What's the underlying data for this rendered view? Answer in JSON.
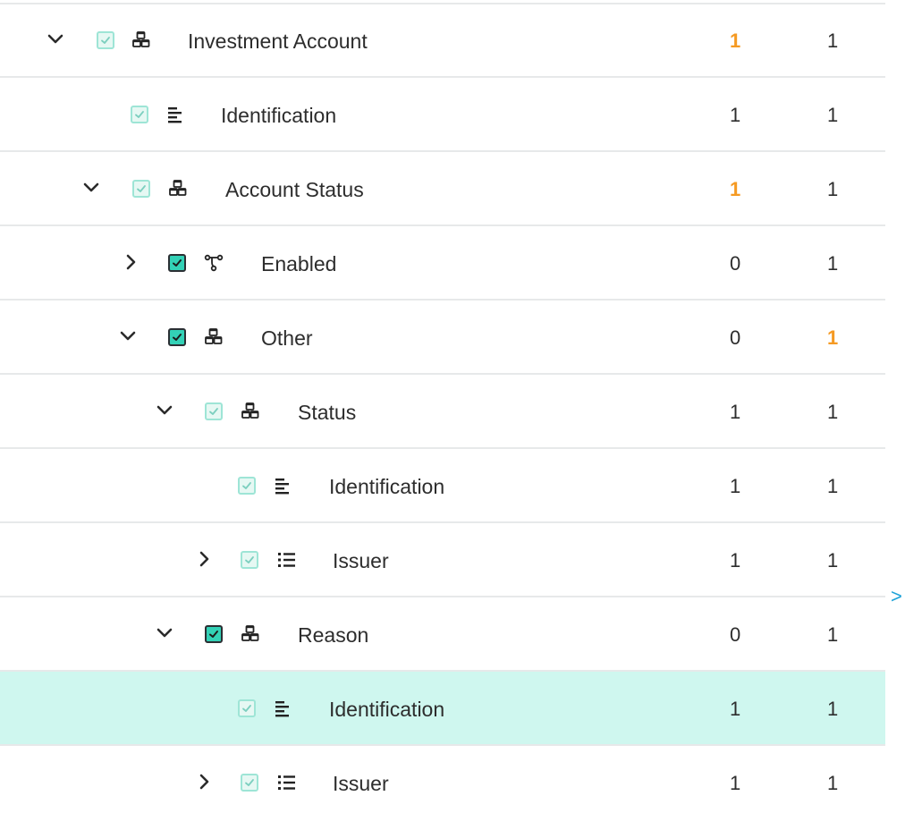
{
  "colors": {
    "accent_orange": "#f59a23",
    "selected_row": "#cff7ef",
    "checkbox_checked": "#33d1b6",
    "side_arrow": "#1ea2d8"
  },
  "side_arrow": ">",
  "rows": [
    {
      "label": "Investment Account",
      "icon": "cubes-icon",
      "toggle": "expanded",
      "checkbox": "light",
      "c1": "1",
      "c2": "1",
      "c1_highlight": true,
      "c2_highlight": false
    },
    {
      "label": "Identification",
      "icon": "text-lines-icon",
      "toggle": "none",
      "checkbox": "light",
      "c1": "1",
      "c2": "1",
      "c1_highlight": false,
      "c2_highlight": false
    },
    {
      "label": "Account Status",
      "icon": "cubes-icon",
      "toggle": "expanded",
      "checkbox": "light",
      "c1": "1",
      "c2": "1",
      "c1_highlight": true,
      "c2_highlight": false
    },
    {
      "label": "Enabled",
      "icon": "branch-icon",
      "toggle": "collapsed",
      "checkbox": "strong",
      "c1": "0",
      "c2": "1",
      "c1_highlight": false,
      "c2_highlight": false
    },
    {
      "label": "Other",
      "icon": "cubes-icon",
      "toggle": "expanded",
      "checkbox": "strong",
      "c1": "0",
      "c2": "1",
      "c1_highlight": false,
      "c2_highlight": true
    },
    {
      "label": "Status",
      "icon": "cubes-icon",
      "toggle": "expanded",
      "checkbox": "light",
      "c1": "1",
      "c2": "1",
      "c1_highlight": false,
      "c2_highlight": false
    },
    {
      "label": "Identification",
      "icon": "text-lines-icon",
      "toggle": "none",
      "checkbox": "light",
      "c1": "1",
      "c2": "1",
      "c1_highlight": false,
      "c2_highlight": false
    },
    {
      "label": "Issuer",
      "icon": "list-icon",
      "toggle": "collapsed",
      "checkbox": "light",
      "c1": "1",
      "c2": "1",
      "c1_highlight": false,
      "c2_highlight": false
    },
    {
      "label": "Reason",
      "icon": "cubes-icon",
      "toggle": "expanded",
      "checkbox": "strong",
      "c1": "0",
      "c2": "1",
      "c1_highlight": false,
      "c2_highlight": false
    },
    {
      "label": "Identification",
      "icon": "text-lines-icon",
      "toggle": "none",
      "checkbox": "light",
      "c1": "1",
      "c2": "1",
      "c1_highlight": false,
      "c2_highlight": false,
      "selected": true
    },
    {
      "label": "Issuer",
      "icon": "list-icon",
      "toggle": "collapsed",
      "checkbox": "light",
      "c1": "1",
      "c2": "1",
      "c1_highlight": false,
      "c2_highlight": false
    }
  ]
}
